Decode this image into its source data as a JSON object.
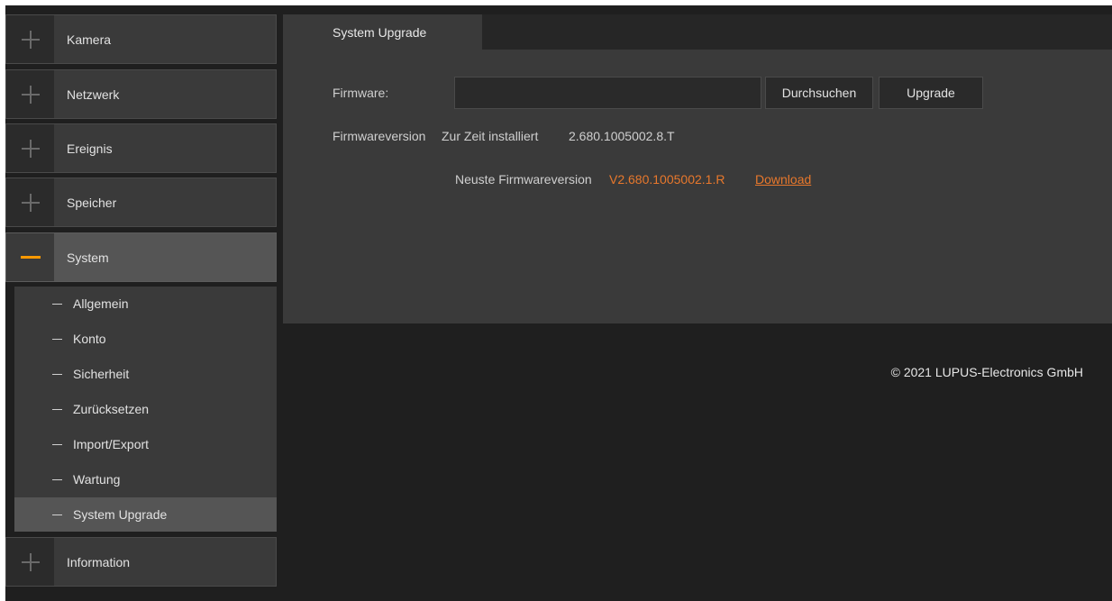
{
  "sidebar": {
    "items": [
      {
        "label": "Kamera",
        "icon": "plus-icon"
      },
      {
        "label": "Netzwerk",
        "icon": "plus-icon"
      },
      {
        "label": "Ereignis",
        "icon": "plus-icon"
      },
      {
        "label": "Speicher",
        "icon": "plus-icon"
      },
      {
        "label": "System",
        "icon": "minus-icon"
      },
      {
        "label": "Information",
        "icon": "plus-icon"
      }
    ],
    "submenu": [
      {
        "label": "Allgemein"
      },
      {
        "label": "Konto"
      },
      {
        "label": "Sicherheit"
      },
      {
        "label": "Zurücksetzen"
      },
      {
        "label": "Import/Export"
      },
      {
        "label": "Wartung"
      },
      {
        "label": "System Upgrade"
      }
    ]
  },
  "main": {
    "tab_label": "System Upgrade",
    "firmware_label": "Firmware:",
    "firmware_value": "",
    "browse_button": "Durchsuchen",
    "upgrade_button": "Upgrade",
    "version_label": "Firmwareversion",
    "installed_prefix": "Zur Zeit installiert",
    "installed_version": "2.680.1005002.8.T",
    "latest_prefix": "Neuste Firmwareversion",
    "latest_version": "V2.680.1005002.1.R",
    "download_link": "Download"
  },
  "footer": {
    "copyright": "© 2021 LUPUS-Electronics GmbH"
  },
  "colors": {
    "accent": "#e8782c",
    "minus_icon": "#ff9900"
  }
}
